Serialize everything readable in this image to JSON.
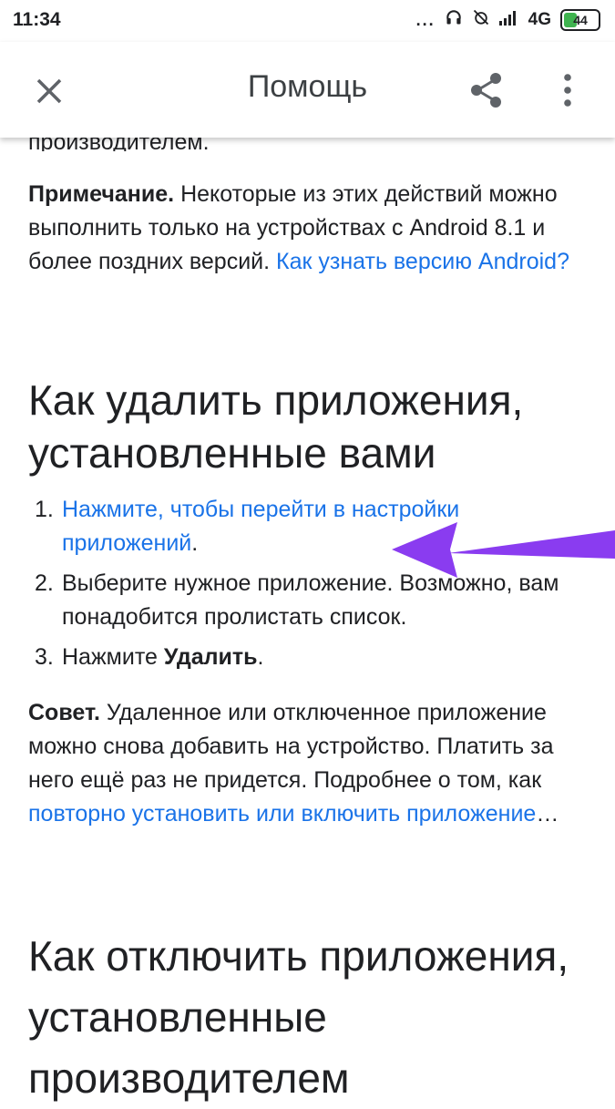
{
  "status_bar": {
    "time": "11:34",
    "more": "...",
    "network": "4G",
    "battery": "44",
    "battery_level": 0.44
  },
  "app_bar": {
    "title": "Помощь",
    "close_icon": "close-icon",
    "share_icon": "share-icon",
    "more_icon": "more-vert-icon"
  },
  "article": {
    "cut_text": "производителем.",
    "note": {
      "label": "Примечание.",
      "text": " Некоторые из этих действий можно выполнить только на устройствах с Android 8.1 и более поздних версий. ",
      "link": "Как узнать версию Android?"
    },
    "remove_heading": "Как удалить приложения, установленные вами",
    "steps": [
      {
        "num": "1.",
        "link": "Нажмите, чтобы перейти в настройки приложений",
        "text": "."
      },
      {
        "num": "2.",
        "text": "Выберите нужное приложение. Возможно, вам понадобится пролистать список."
      },
      {
        "num": "3.",
        "text_before": "Нажмите ",
        "bold": "Удалить",
        "text_after": "."
      }
    ],
    "tip": {
      "label": "Совет.",
      "text": " Удаленное или отключенное приложение можно снова добавить на устройство. Платить за него ещё раз не придется. Подробнее о том, как ",
      "link": "повторно установить или включить приложение",
      "ellipsis": "…"
    },
    "disable_heading": "Как отключить приложения, установленные производителем"
  },
  "colors": {
    "link": "#1a73e8",
    "annotation_arrow": "#8a3cf0"
  }
}
